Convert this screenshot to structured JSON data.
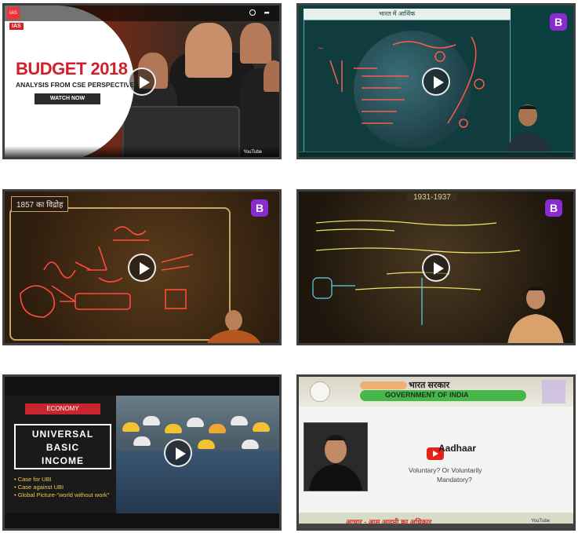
{
  "tiles": [
    {
      "id": "budget-2018",
      "channel_tag": "IAS",
      "headline": "BUDGET 2018",
      "subheadline": "ANALYSIS FROM CSE PERSPECTIVE",
      "cta": "WATCH NOW",
      "player_brand": "YouTube",
      "corner_icon": "share-icon"
    },
    {
      "id": "bharat-me-arthvyavastha",
      "board_title": "भारत में आर्थिक",
      "brand_logo": "B",
      "accent": "#8a2bd1"
    },
    {
      "id": "1857-ka-vidroh",
      "board_title": "1857 का विद्रोह",
      "brand_logo": "B"
    },
    {
      "id": "1931-1937",
      "board_title": "1931-1937",
      "brand_logo": "B"
    },
    {
      "id": "universal-basic-income",
      "section_tag": "ECONOMY",
      "box_lines": [
        "UNIVERSAL",
        "BASIC",
        "INCOME"
      ],
      "bullets": [
        "Case for UBI",
        "Case against UBI",
        "Global Picture-\"world without work\""
      ]
    },
    {
      "id": "aadhaar",
      "hindi_header": "भारत सरकार",
      "banner": "GOVERNMENT OF INDIA",
      "title": "Aadhaar",
      "question_line1": "Voluntary? Or Voluntarily",
      "question_line2": "Mandatory?",
      "footer_hindi": "आधार - आम आदमी का अधिकार",
      "player_brand": "YouTube"
    }
  ]
}
